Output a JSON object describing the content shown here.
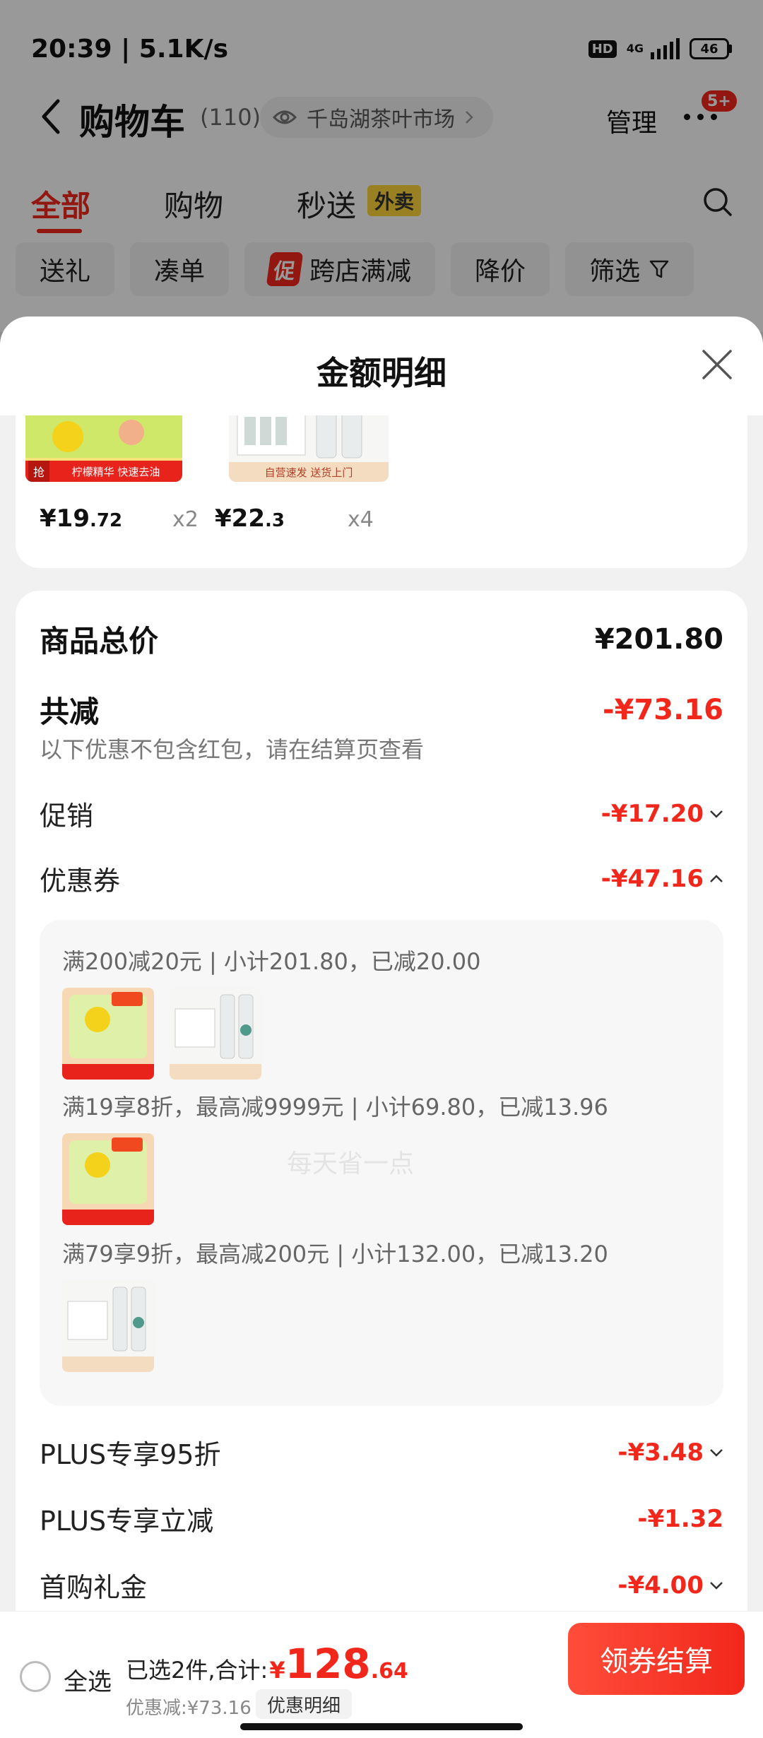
{
  "status_bar": {
    "time": "20:39 | 5.1K/s",
    "hd": "HD",
    "network": "4G",
    "battery": "46"
  },
  "header": {
    "title": "购物车",
    "count": "(110)",
    "market": "千岛湖茶叶市场",
    "manage": "管理",
    "badge": "5+"
  },
  "tabs": [
    {
      "label": "全部"
    },
    {
      "label": "购物"
    },
    {
      "label": "秒送"
    }
  ],
  "tab_tag": "外卖",
  "chips": {
    "gift": "送礼",
    "bundle": "凑单",
    "cu_tag": "促",
    "cross_store": "跨店满减",
    "price_drop": "降价",
    "filter": "筛选"
  },
  "sheet": {
    "title": "金额明细",
    "items": [
      {
        "price_int": "¥19",
        "price_dec": ".72",
        "qty": "x2"
      },
      {
        "price_int": "¥22",
        "price_dec": ".3",
        "qty": "x4"
      }
    ],
    "total_label": "商品总价",
    "total_value": "¥201.80",
    "reduce_label": "共减",
    "reduce_value": "-¥73.16",
    "reduce_note": "以下优惠不包含红包，请在结算页查看",
    "promo_label": "促销",
    "promo_value": "-¥17.20",
    "coupon_label": "优惠券",
    "coupon_value": "-¥47.16",
    "coupon_rows": [
      "满200减20元 | 小计201.80，已减20.00",
      "满19享8折，最高减9999元 | 小计69.80，已减13.96",
      "满79享9折，最高减200元 | 小计132.00，已减13.20"
    ],
    "plus95_label": "PLUS专享95折",
    "plus95_value": "-¥3.48",
    "plus_cut_label": "PLUS专享立减",
    "plus_cut_value": "-¥1.32",
    "first_label": "首购礼金",
    "first_value": "-¥4.00",
    "watermark": "每天省一点"
  },
  "bottom": {
    "select_all": "全选",
    "summary_prefix": "已选2件,合计:",
    "yuan": "¥",
    "total_int": "128",
    "total_dec": ".64",
    "saved": "优惠减:¥73.16",
    "detail_btn": "优惠明细",
    "checkout": "领券结算"
  },
  "colors": {
    "accent": "#f2271c",
    "tag_yellow": "#ffd53a"
  },
  "product_tags": {
    "lemon_flash": "抢",
    "lemon_banner": "柠檬精华 快速去油",
    "water_banner": "自营速发 送货上门"
  }
}
